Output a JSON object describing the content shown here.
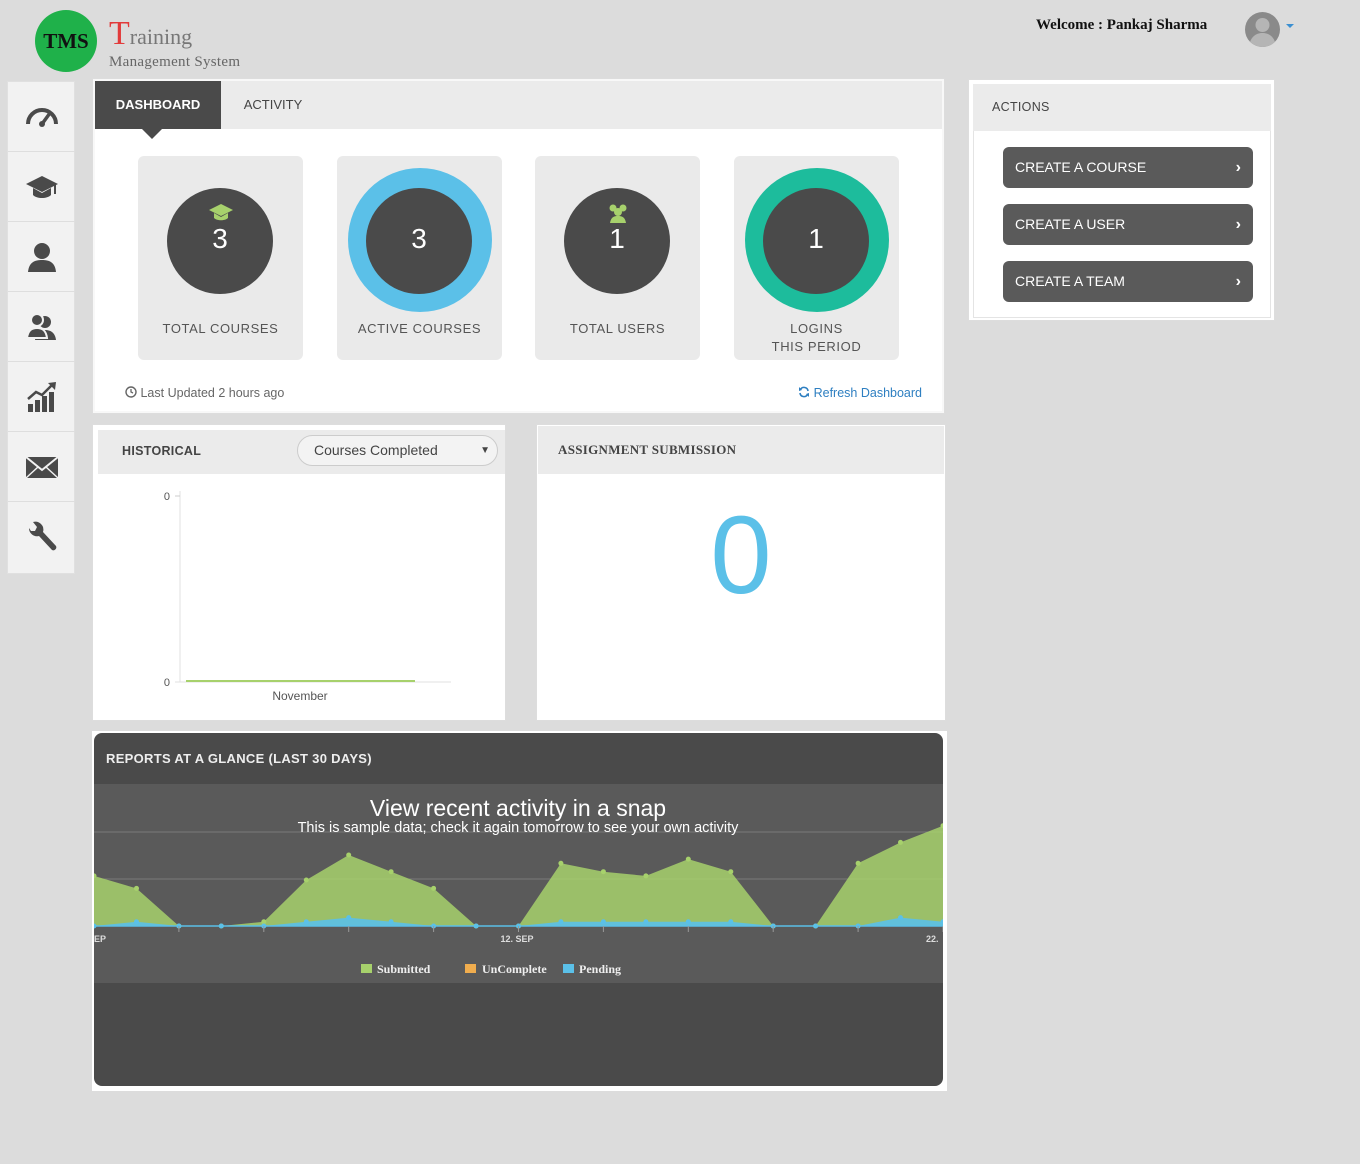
{
  "header": {
    "logo_text": "TMS",
    "title_first": "T",
    "title_rest": "raining",
    "subtitle": "Management System",
    "welcome": "Welcome :  Pankaj Sharma"
  },
  "sidebar": {
    "items": [
      {
        "icon": "speedometer-icon"
      },
      {
        "icon": "graduation-cap-icon"
      },
      {
        "icon": "user-icon"
      },
      {
        "icon": "users-icon"
      },
      {
        "icon": "chart-growth-icon"
      },
      {
        "icon": "envelope-icon"
      },
      {
        "icon": "wrench-icon"
      }
    ]
  },
  "dashboard": {
    "tabs": [
      {
        "label": "DASHBOARD"
      },
      {
        "label": "ACTIVITY"
      }
    ],
    "stats": [
      {
        "value": "3",
        "label": "TOTAL COURSES",
        "icon": "graduation-cap-icon"
      },
      {
        "value": "3",
        "label": "ACTIVE COURSES"
      },
      {
        "value": "1",
        "label": "TOTAL USERS",
        "icon": "users-icon"
      },
      {
        "value": "1",
        "label_line1": "LOGINS",
        "label_line2": "THIS PERIOD"
      }
    ],
    "last_updated": "Last Updated 2 hours ago",
    "refresh": "Refresh Dashboard",
    "colors": {
      "ring_active": "#5bc0e8",
      "ring_logins": "#1dbc9c",
      "icon_green": "#a7d16c"
    }
  },
  "historical": {
    "title": "HISTORICAL",
    "select_value": "Courses Completed",
    "chart_data": {
      "type": "line",
      "categories": [
        "November"
      ],
      "series": [
        {
          "values": [
            0
          ]
        }
      ],
      "y_tick_labels": [
        "0",
        "0"
      ]
    }
  },
  "assignment": {
    "title": "ASSIGNMENT SUBMISSION",
    "value": "0"
  },
  "reports": {
    "title": "REPORTS AT A GLANCE (LAST 30 DAYS)",
    "headline": "View recent activity in a snap",
    "subline": "This is sample data; check it again tomorrow to see your own activity",
    "chart_data": {
      "type": "area",
      "x_tick_labels": [
        "EP",
        "12. SEP",
        "22."
      ],
      "series": [
        {
          "name": "Submitted",
          "color": "#a7d16c",
          "values": [
            12,
            9,
            0,
            0,
            1,
            11,
            17,
            13,
            9,
            0,
            0,
            15,
            13,
            12,
            16,
            13,
            0,
            0,
            15,
            20,
            24
          ]
        },
        {
          "name": "UnComplete",
          "color": "#f0ad4e",
          "values": [
            0,
            0,
            0,
            0,
            0,
            0,
            0,
            0,
            0,
            0,
            0,
            0,
            0,
            0,
            0,
            0,
            0,
            0,
            0,
            0,
            0
          ]
        },
        {
          "name": "Pending",
          "color": "#5bc0e8",
          "values": [
            0,
            1,
            0,
            0,
            0,
            1,
            2,
            1,
            0,
            0,
            0,
            1,
            1,
            1,
            1,
            1,
            0,
            0,
            0,
            2,
            1
          ]
        }
      ]
    }
  },
  "actions": {
    "title": "ACTIONS",
    "buttons": [
      {
        "label": "CREATE A COURSE"
      },
      {
        "label": "CREATE A USER"
      },
      {
        "label": "CREATE A TEAM"
      }
    ]
  }
}
